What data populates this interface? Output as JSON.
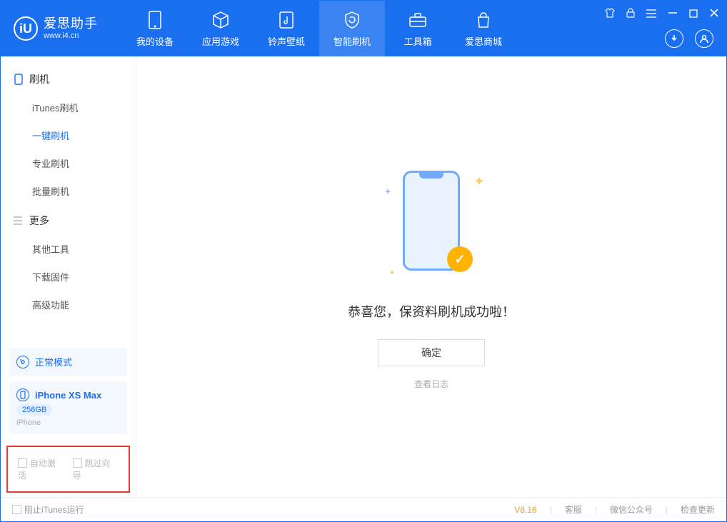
{
  "app": {
    "name": "爱思助手",
    "url": "www.i4.cn"
  },
  "tabs": {
    "device": "我的设备",
    "apps": "应用游戏",
    "ringtones": "铃声壁纸",
    "flash": "智能刷机",
    "toolbox": "工具箱",
    "store": "爱思商城"
  },
  "sidebar": {
    "section_flash": "刷机",
    "items_flash": {
      "itunes": "iTunes刷机",
      "oneclick": "一键刷机",
      "pro": "专业刷机",
      "batch": "批量刷机"
    },
    "section_more": "更多",
    "items_more": {
      "other": "其他工具",
      "firmware": "下载固件",
      "advanced": "高级功能"
    }
  },
  "device_mode": "正常模式",
  "device": {
    "name": "iPhone XS Max",
    "storage": "256GB",
    "type": "iPhone"
  },
  "options": {
    "auto_activate": "自动激活",
    "skip_guide": "跳过向导"
  },
  "main": {
    "success": "恭喜您，保资料刷机成功啦！",
    "ok": "确定",
    "view_log": "查看日志"
  },
  "status": {
    "block_itunes": "阻止iTunes运行",
    "version": "V8.16",
    "support": "客服",
    "wechat": "微信公众号",
    "update": "检查更新"
  }
}
